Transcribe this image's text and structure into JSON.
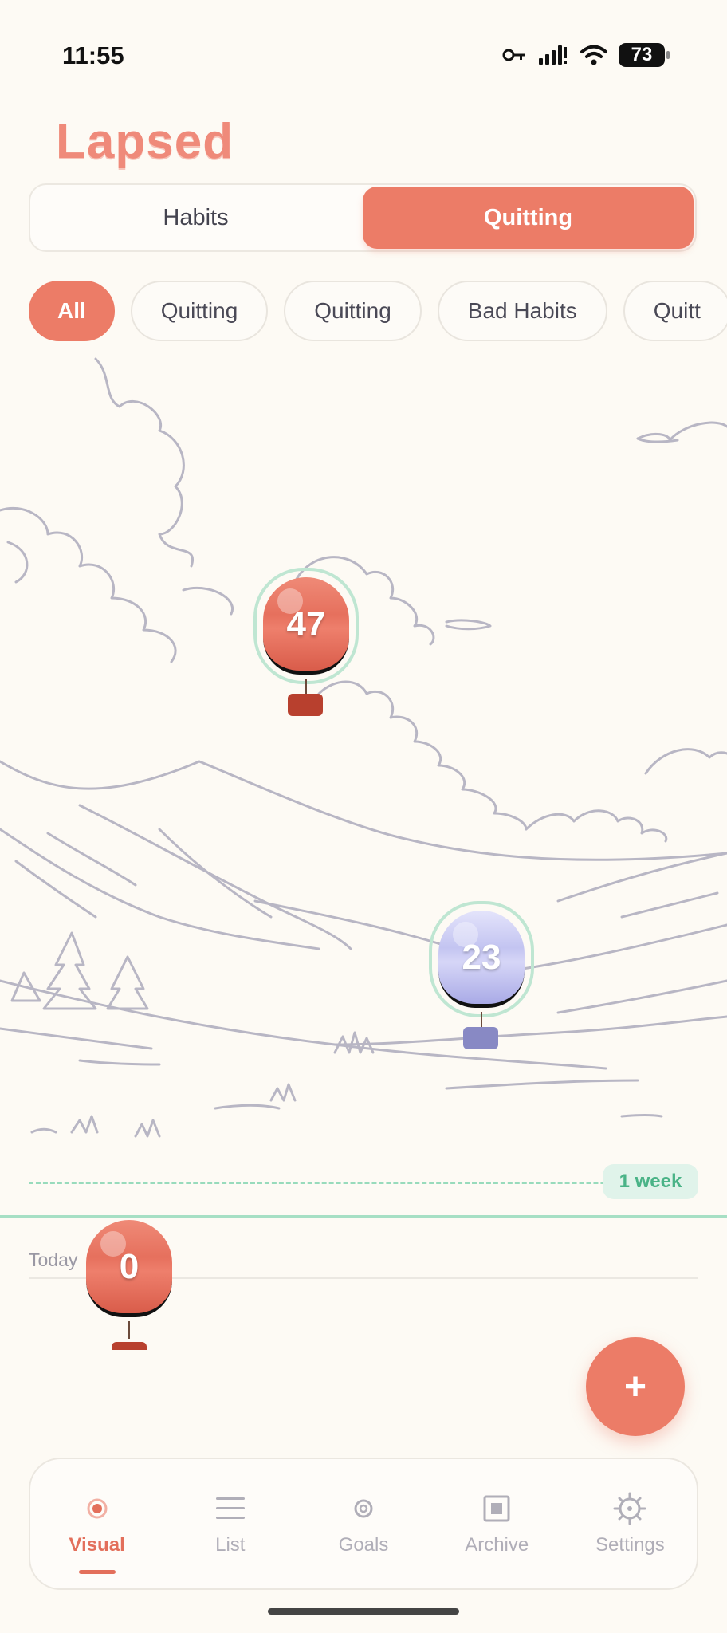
{
  "status_bar": {
    "time": "11:55",
    "battery": "73"
  },
  "app": {
    "title": "Lapsed"
  },
  "segments": [
    {
      "label": "Habits",
      "active": false
    },
    {
      "label": "Quitting",
      "active": true
    }
  ],
  "filters": [
    {
      "label": "All",
      "active": true
    },
    {
      "label": "Quitting",
      "active": false
    },
    {
      "label": "Quitting",
      "active": false
    },
    {
      "label": "Bad Habits",
      "active": false
    },
    {
      "label": "Quitt",
      "active": false
    }
  ],
  "balloons": [
    {
      "count": "47",
      "color": "red"
    },
    {
      "count": "23",
      "color": "purple"
    },
    {
      "count": "0",
      "color": "red"
    }
  ],
  "timeline": {
    "week_marker": "1 week",
    "today_label": "Today"
  },
  "fab": {
    "label": "+"
  },
  "tabs": [
    {
      "label": "Visual",
      "icon": "visual-dot-icon",
      "active": true
    },
    {
      "label": "List",
      "icon": "list-icon",
      "active": false
    },
    {
      "label": "Goals",
      "icon": "goals-target-icon",
      "active": false
    },
    {
      "label": "Archive",
      "icon": "archive-box-icon",
      "active": false
    },
    {
      "label": "Settings",
      "icon": "settings-gear-icon",
      "active": false
    }
  ],
  "colors": {
    "accent": "#ec7c67",
    "week_green": "#4ab387",
    "balloon_purple": "#c3c4f1"
  }
}
